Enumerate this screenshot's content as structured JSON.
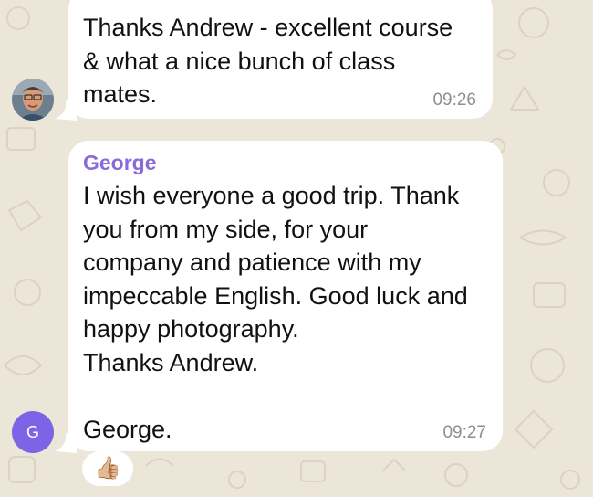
{
  "messages": [
    {
      "id": "msg-1",
      "sender": "",
      "text": "Thanks Andrew - excellent course\n& what a nice bunch of class\nmates.",
      "time": "09:26"
    },
    {
      "id": "msg-2",
      "sender": "George",
      "avatar_initial": "G",
      "text": "I wish everyone a good trip. Thank\nyou from my side, for your\ncompany and patience with my\nimpeccable English. Good luck and\nhappy photography.\nThanks Andrew.\n\nGeorge.",
      "time": "09:27",
      "reaction": "👍🏼"
    }
  ],
  "colors": {
    "background": "#ece6d9",
    "bubble": "#ffffff",
    "sender_name": "#8a6bdc",
    "avatar_george": "#7c64e6",
    "timestamp": "#8e8e8e"
  }
}
